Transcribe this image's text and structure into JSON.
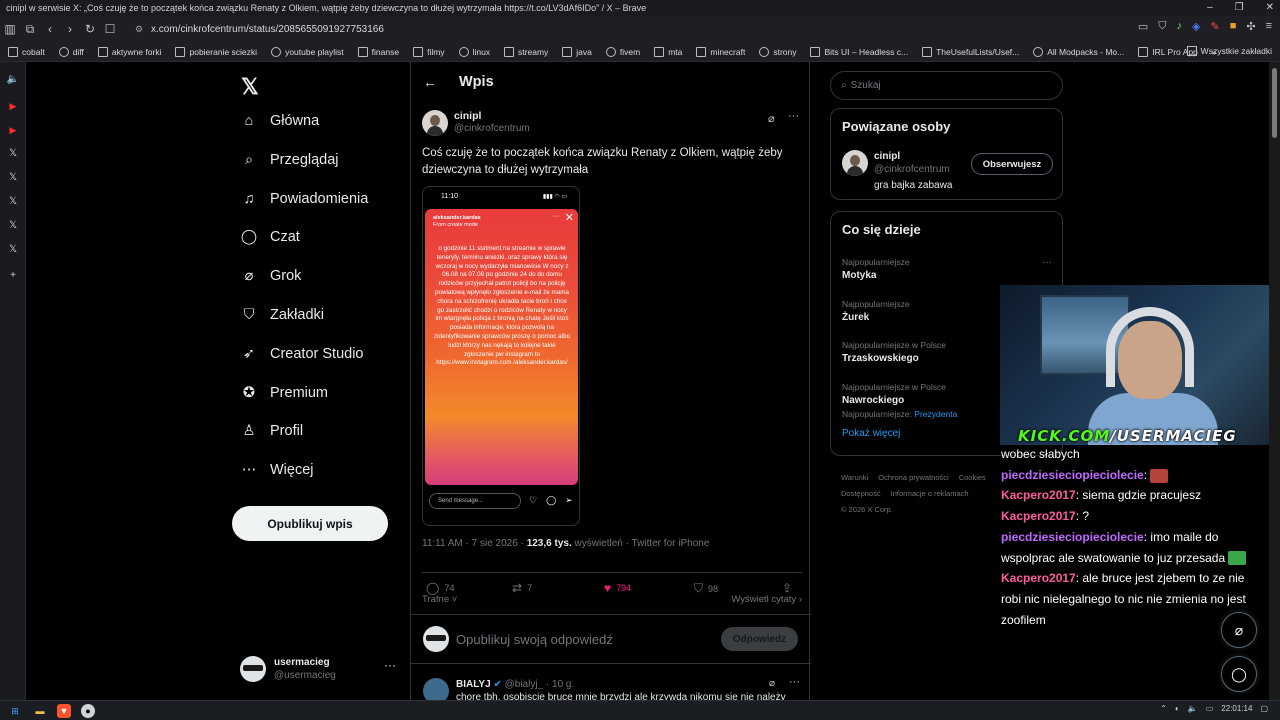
{
  "browser": {
    "window_title": "cinipl w serwisie X: „Coś czuję że to początek końca związku Renaty z Olkiem, wątpię żeby dziewczyna to dłużej wytrzymała https://t.co/LV3dAf6IDo” / X – Brave",
    "url": "x.com/cinkrofcentrum/status/2085655091927753166",
    "bookmarks": [
      "cobalt",
      "diff",
      "aktywne forki",
      "pobieranie sciezki",
      "youtube playlist",
      "finanse",
      "filmy",
      "linux",
      "streamy",
      "java",
      "fivem",
      "mta",
      "minecraft",
      "strony",
      "Bits UI – Headless c...",
      "TheUsefulLists/Usef...",
      "All Modpacks - Mo...",
      "IRL Pro App"
    ],
    "bookmarks_overflow": "»",
    "bookmarks_folder": "Wszystkie zakładki"
  },
  "nav": {
    "items": [
      {
        "label": "Główna",
        "icon": "home-icon"
      },
      {
        "label": "Przeglądaj",
        "icon": "search-icon"
      },
      {
        "label": "Powiadomienia",
        "icon": "bell-icon"
      },
      {
        "label": "Czat",
        "icon": "chat-icon"
      },
      {
        "label": "Grok",
        "icon": "grok-icon"
      },
      {
        "label": "Zakładki",
        "icon": "bookmark-icon"
      },
      {
        "label": "Creator Studio",
        "icon": "rocket-icon"
      },
      {
        "label": "Premium",
        "icon": "verified-icon"
      },
      {
        "label": "Profil",
        "icon": "person-icon"
      },
      {
        "label": "Więcej",
        "icon": "more-circle-icon"
      }
    ],
    "post_button": "Opublikuj wpis",
    "account_name": "usermacieg",
    "account_handle": "@usermacieg"
  },
  "post": {
    "header_title": "Wpis",
    "author_name": "cinipl",
    "author_handle": "@cinkrofcentrum",
    "text": "Coś czuję że to początek końca związku Renaty z Olkiem, wątpię żeby dziewczyna to dłużej wytrzymała",
    "story_time": "11:10",
    "story_user": "aleksander.kardas",
    "story_from": "From create mode",
    "story_text": "o godzinie 11 statment na streamie w sprawie teneryfy, terminu aniezki, oraz sprawy która się wczoraj w nocy wydarzyła mianowicie W nocy z 06.08 na 07.08 po godzinie 24 do do domu rodziców przyjechał patrol policji bo na policję powiatową wpłynęło zgłoszenie e-mail że mama chora na schizofrenię ukradła tacie broń i chce go zastrzelić chodzi o rodziców Renaty w nocy im wtargnęła policja z bronią na chatę Jeśli ktoś posiada informacje, która pozwolą na zidentyfikowanie sprawców proszę o pomoc albo ludzi którzy nas nękają to kolejne takie zgłoszenie pw instagram to https://www.instagram.com /aleksander.kardas/",
    "story_message_placeholder": "Send message...",
    "time": "11:11 AM · 7 sie 2026 · ",
    "views": "123,6 tys.",
    "views_label": " wyświetleń · Twitter for iPhone",
    "replies": "74",
    "reposts": "7",
    "likes": "794",
    "bookmarks": "98",
    "sort_label": "Trafne",
    "quotes_label": "Wyświetl cytaty",
    "reply_placeholder": "Opublikuj swoją odpowiedź",
    "reply_button": "Odpowiedz",
    "next_author": "BIALYJ",
    "next_handle": "@bialyj_",
    "next_time": "· 10 g.",
    "next_text": "chore tbh, osobiscie bruce mnie brzydzi ale krzywda nikomu sie nie należy"
  },
  "sidebar": {
    "search_placeholder": "Szukaj",
    "related_title": "Powiązane osoby",
    "related_name": "cinipl",
    "related_handle": "@cinkrofcentrum",
    "related_bio": "gra bajka zabawa",
    "follow_button": "Obserwujesz",
    "trending_title": "Co się dzieje",
    "trends": [
      {
        "category": "Najpopularniejsze",
        "name": "Motyka",
        "sub": "",
        "sub_link": ""
      },
      {
        "category": "Najpopularniejsze",
        "name": "Żurek",
        "sub": "",
        "sub_link": ""
      },
      {
        "category": "Najpopularniejsze w Polsce",
        "name": "Trzaskowskiego",
        "sub": "",
        "sub_link": ""
      },
      {
        "category": "Najpopularniejsze w Polsce",
        "name": "Nawrockiego",
        "sub": "Najpopularniejsze: ",
        "sub_link": "Prezydenta"
      }
    ],
    "show_more": "Pokaż więcej",
    "footer": [
      "Warunki",
      "Ochrona prywatności",
      "Cookies",
      "Dostępność",
      "Informacje o reklamach",
      "© 2026 X Corp."
    ]
  },
  "overlay": {
    "kick_prefix": "KICK.COM",
    "kick_slash": "/",
    "kick_user": "USERMACIEG",
    "chat": [
      {
        "user": "",
        "text": "wobec słabych"
      },
      {
        "user": "piecdziesieciopieciolecie",
        "text": ":"
      },
      {
        "user": "Kacpero2017",
        "text": ": siema gdzie pracujesz"
      },
      {
        "user": "Kacpero2017",
        "text": ": ?"
      },
      {
        "user": "piecdziesieciopieciolecie",
        "text": ": imo maile do wspolprac  ale swatowanie to juz przesada"
      },
      {
        "user": "Kacpero2017",
        "text": ": ale bruce jest zjebem to ze nie robi nic nielegalnego to nic nie zmienia no jest zoofilem"
      }
    ]
  },
  "taskbar": {
    "clock": "22:01:14"
  }
}
